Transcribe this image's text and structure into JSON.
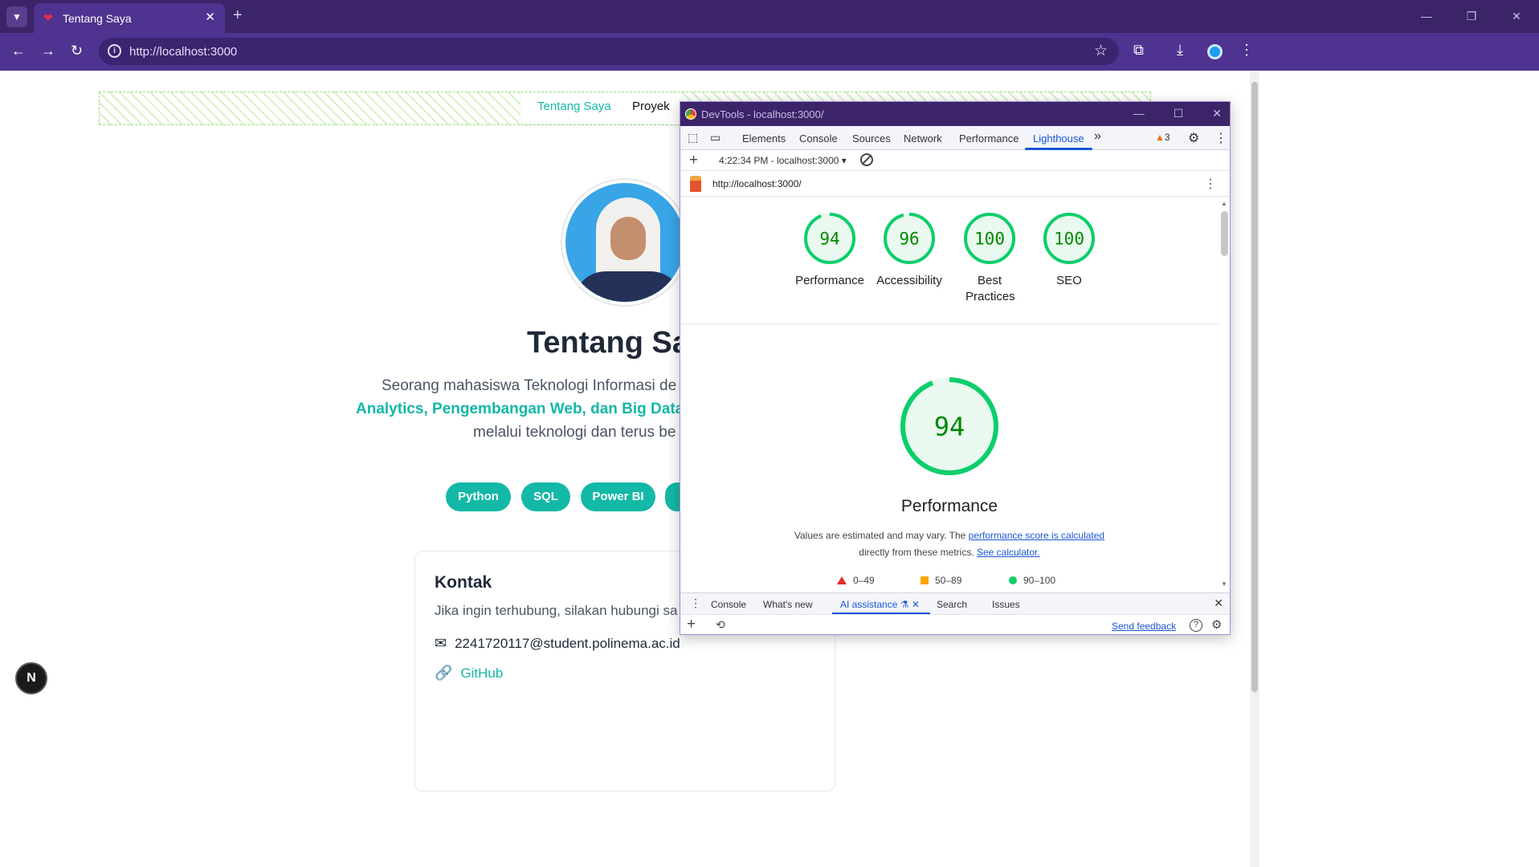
{
  "browser": {
    "tab_title": "Tentang Saya",
    "tab_close": "✕",
    "new_tab": "+",
    "url": "http://localhost:3000",
    "window_controls": [
      "—",
      "❐",
      "✕"
    ],
    "icons": {
      "back": "arrow-left",
      "forward": "arrow-right",
      "reload": "reload",
      "bookmark": "star",
      "extensions": "puzzle",
      "downloads": "download",
      "menu": "kebab"
    }
  },
  "site": {
    "nav": {
      "active_label": "Tentang Saya",
      "other_label": "Proyek"
    },
    "hero": {
      "title": "Tentang Sa",
      "desc_line1": "Seorang mahasiswa Teknologi Informasi de",
      "desc_line2": "Analytics, Pengembangan Web, dan Big Data",
      "desc_line3": "melalui teknologi dan terus be"
    },
    "skills": [
      "Python",
      "SQL",
      "Power BI"
    ],
    "contact": {
      "title": "Kontak",
      "desc": "Jika ingin terhubung, silakan hubungi sa",
      "email": "2241720117@student.polinema.ac.id",
      "github": "GitHub"
    },
    "framework_badge": "N"
  },
  "devtools": {
    "window_title": "DevTools - localhost:3000/",
    "window_controls": [
      "—",
      "☐",
      "✕"
    ],
    "tabs": [
      "Elements",
      "Console",
      "Sources",
      "Network",
      "Performance",
      "Lighthouse"
    ],
    "active_tab": "Lighthouse",
    "more_tabs": "»",
    "warnings": "3",
    "lighthouse": {
      "run_label": "4:22:34 PM - localhost:3000",
      "report_url": "http://localhost:3000/",
      "categories": [
        {
          "label": "Performance",
          "score": "94",
          "value": 94
        },
        {
          "label": "Accessibility",
          "score": "96",
          "value": 96
        },
        {
          "label": "Best Practices",
          "score": "100",
          "value": 100
        },
        {
          "label": "SEO",
          "score": "100",
          "value": 100
        }
      ],
      "detail": {
        "score": "94",
        "value": 94,
        "title": "Performance",
        "note_prefix": "Values are estimated and may vary. The ",
        "note_link1": "performance score is calculated",
        "note_mid": "directly from these metrics. ",
        "note_link2": "See calculator."
      },
      "legend": [
        {
          "range": "0–49",
          "color": "#e22a2a"
        },
        {
          "range": "50–89",
          "color": "#ffa400"
        },
        {
          "range": "90–100",
          "color": "#0cce6b"
        }
      ]
    },
    "drawer": {
      "tabs": [
        "Console",
        "What's new",
        "AI assistance",
        "Search",
        "Issues"
      ],
      "active_tab": "AI assistance",
      "send_feedback": "Send feedback"
    }
  },
  "colors": {
    "accent_teal": "#14b8a6",
    "browser_purple": "#4f3390",
    "lh_pass": "#0cce6b",
    "lh_pass_fill": "#e9f9ef",
    "lh_pass_text": "#008800"
  }
}
